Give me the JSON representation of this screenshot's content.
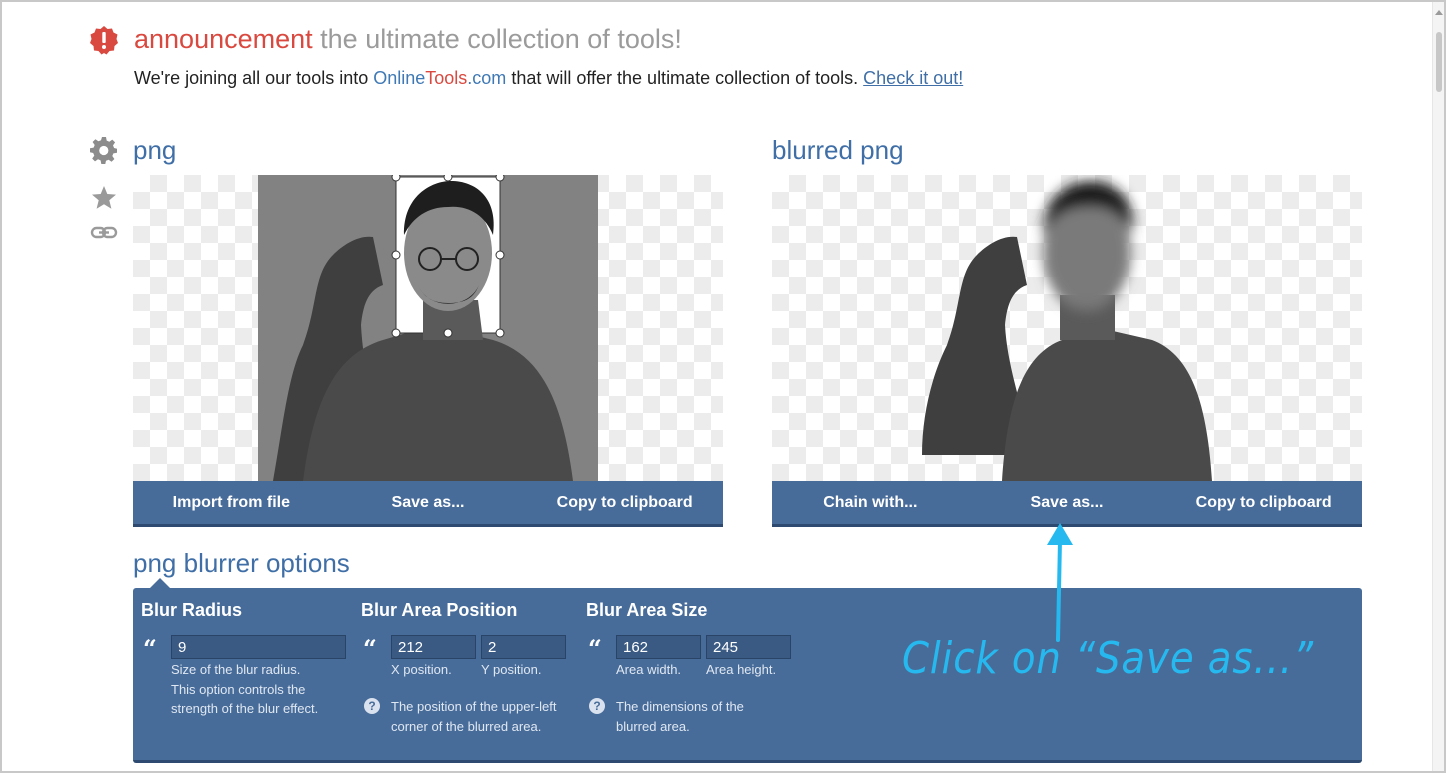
{
  "announcement": {
    "label": "announcement",
    "headline": "the ultimate collection of tools!",
    "text_before": "We're joining all our tools into ",
    "brand_online": "Online",
    "brand_tools": "Tools",
    "brand_com": ".com",
    "text_after": " that will offer the ultimate collection of tools. ",
    "link": "Check it out!"
  },
  "side_icons": [
    "gear-icon",
    "star-icon",
    "link-icon"
  ],
  "input_panel": {
    "title": "png",
    "buttons": [
      "Import from file",
      "Save as...",
      "Copy to clipboard"
    ]
  },
  "output_panel": {
    "title": "blurred png",
    "buttons": [
      "Chain with...",
      "Save as...",
      "Copy to clipboard"
    ]
  },
  "options": {
    "title": "png blurrer options",
    "blur_radius": {
      "title": "Blur Radius",
      "value": "9",
      "hint1": "Size of the blur radius.",
      "hint2": "This option controls the",
      "hint3": "strength of the blur effect."
    },
    "blur_area_position": {
      "title": "Blur Area Position",
      "x_value": "212",
      "y_value": "2",
      "x_label": "X position.",
      "y_label": "Y position.",
      "help1": "The position of the upper-left",
      "help2": "corner of the blurred area."
    },
    "blur_area_size": {
      "title": "Blur Area Size",
      "width_value": "162",
      "height_value": "245",
      "width_label": "Area width.",
      "height_label": "Area height.",
      "help1": "The dimensions of the",
      "help2": "blurred area."
    }
  },
  "annotation": {
    "text": "Click on “Save as...”",
    "color": "#26b9ef"
  },
  "colors": {
    "accent_blue": "#486c9a",
    "heading_blue": "#3f6fa6",
    "announcement_red": "#d9493f"
  }
}
